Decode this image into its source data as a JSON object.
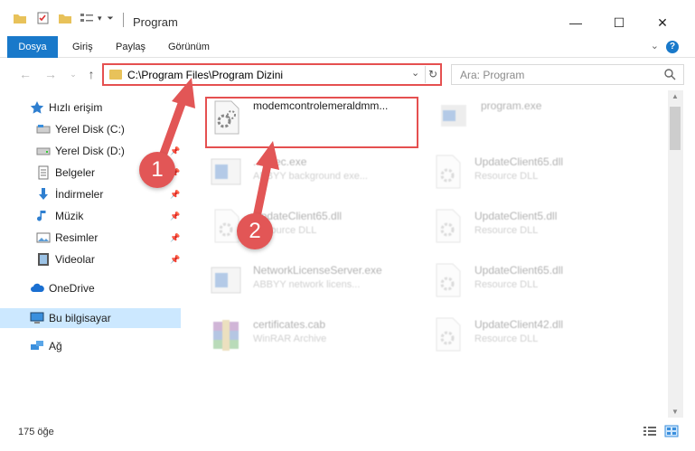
{
  "window": {
    "title": "Program",
    "minimize": "—",
    "maximize": "☐",
    "close": "✕"
  },
  "ribbon": {
    "tabs": [
      "Dosya",
      "Giriş",
      "Paylaş",
      "Görünüm"
    ],
    "help": "?"
  },
  "address": {
    "path": "C:\\Program Files\\Program Dizini",
    "search_placeholder": "Ara: Program"
  },
  "nav": {
    "items": [
      {
        "label": "Hızlı erişim",
        "icon": "star-icon"
      },
      {
        "label": "Yerel Disk (C:)",
        "icon": "drive-icon"
      },
      {
        "label": "Yerel Disk (D:)",
        "icon": "drive-icon"
      },
      {
        "label": "Belgeler",
        "icon": "documents-icon"
      },
      {
        "label": "İndirmeler",
        "icon": "download-icon"
      },
      {
        "label": "Müzik",
        "icon": "music-icon"
      },
      {
        "label": "Resimler",
        "icon": "pictures-icon"
      },
      {
        "label": "Videolar",
        "icon": "videos-icon"
      },
      {
        "label": "OneDrive",
        "icon": "cloud-icon"
      },
      {
        "label": "Bu bilgisayar",
        "icon": "computer-icon"
      },
      {
        "label": "Ağ",
        "icon": "network-icon"
      }
    ]
  },
  "files": [
    {
      "name": "modemcontrolemeraldmm...",
      "type": "",
      "icon": "gear-file-icon"
    },
    {
      "name": "program.exe",
      "type": "",
      "icon": "exe-icon"
    },
    {
      "name": "...Exec.exe",
      "type": "ABBYY background exe...",
      "icon": "exe-icon"
    },
    {
      "name": "UpdateClient65.dll",
      "type": "Resource DLL",
      "icon": "dll-icon"
    },
    {
      "name": "UpdateClient65.dll",
      "type": "Resource DLL",
      "icon": "dll-icon"
    },
    {
      "name": "UpdateClient5.dll",
      "type": "Resource DLL",
      "icon": "dll-icon"
    },
    {
      "name": "NetworkLicenseServer.exe",
      "type": "ABBYY network licens...",
      "icon": "exe-icon"
    },
    {
      "name": "UpdateClient65.dll",
      "type": "Resource DLL",
      "icon": "dll-icon"
    },
    {
      "name": "certificates.cab",
      "type": "WinRAR Archive",
      "icon": "archive-icon"
    },
    {
      "name": "UpdateClient42.dll",
      "type": "Resource DLL",
      "icon": "dll-icon"
    }
  ],
  "status": {
    "count": "175 öğe"
  },
  "annotations": {
    "marker1": "1",
    "marker2": "2"
  },
  "colors": {
    "accent": "#1979ca",
    "highlight": "#e55050",
    "marker": "#e25656"
  }
}
